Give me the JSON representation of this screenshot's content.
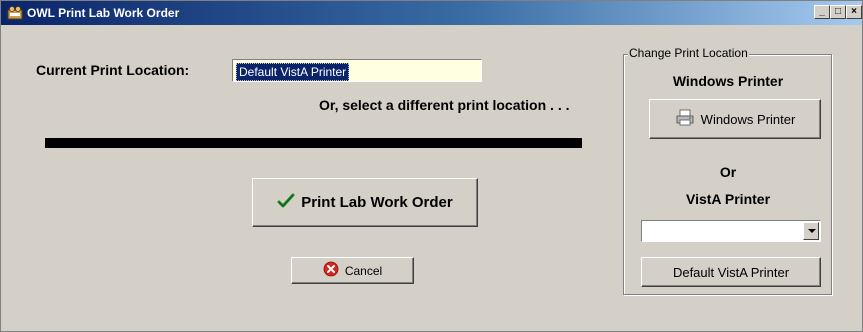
{
  "window": {
    "title": "OWL Print Lab Work Order",
    "controls": {
      "minimize": "_",
      "maximize": "□",
      "close": "×"
    }
  },
  "main": {
    "current_location_label": "Current Print Location:",
    "current_location_value": "Default VistA Printer",
    "select_prompt": "Or, select a different print location . . .",
    "print_button_label": "Print Lab Work Order",
    "cancel_button_label": "Cancel"
  },
  "group": {
    "legend": "Change Print Location",
    "windows_heading": "Windows Printer",
    "windows_button_label": "Windows Printer",
    "or_label": "Or",
    "vista_heading": "VistA Printer",
    "vista_select_value": "",
    "default_vista_button_label": "Default VistA Printer"
  },
  "colors": {
    "titlebar_start": "#0a246a",
    "titlebar_end": "#a6caf0",
    "window_bg": "#d4d0c8",
    "field_bg": "#ffffe1",
    "selection_bg": "#0a246a",
    "check_green": "#1f8a2a",
    "cancel_red": "#d9261c"
  },
  "icons": {
    "title": "app-icon",
    "print": "checkmark-icon",
    "cancel": "cancel-icon",
    "windows_printer": "printer-icon"
  }
}
